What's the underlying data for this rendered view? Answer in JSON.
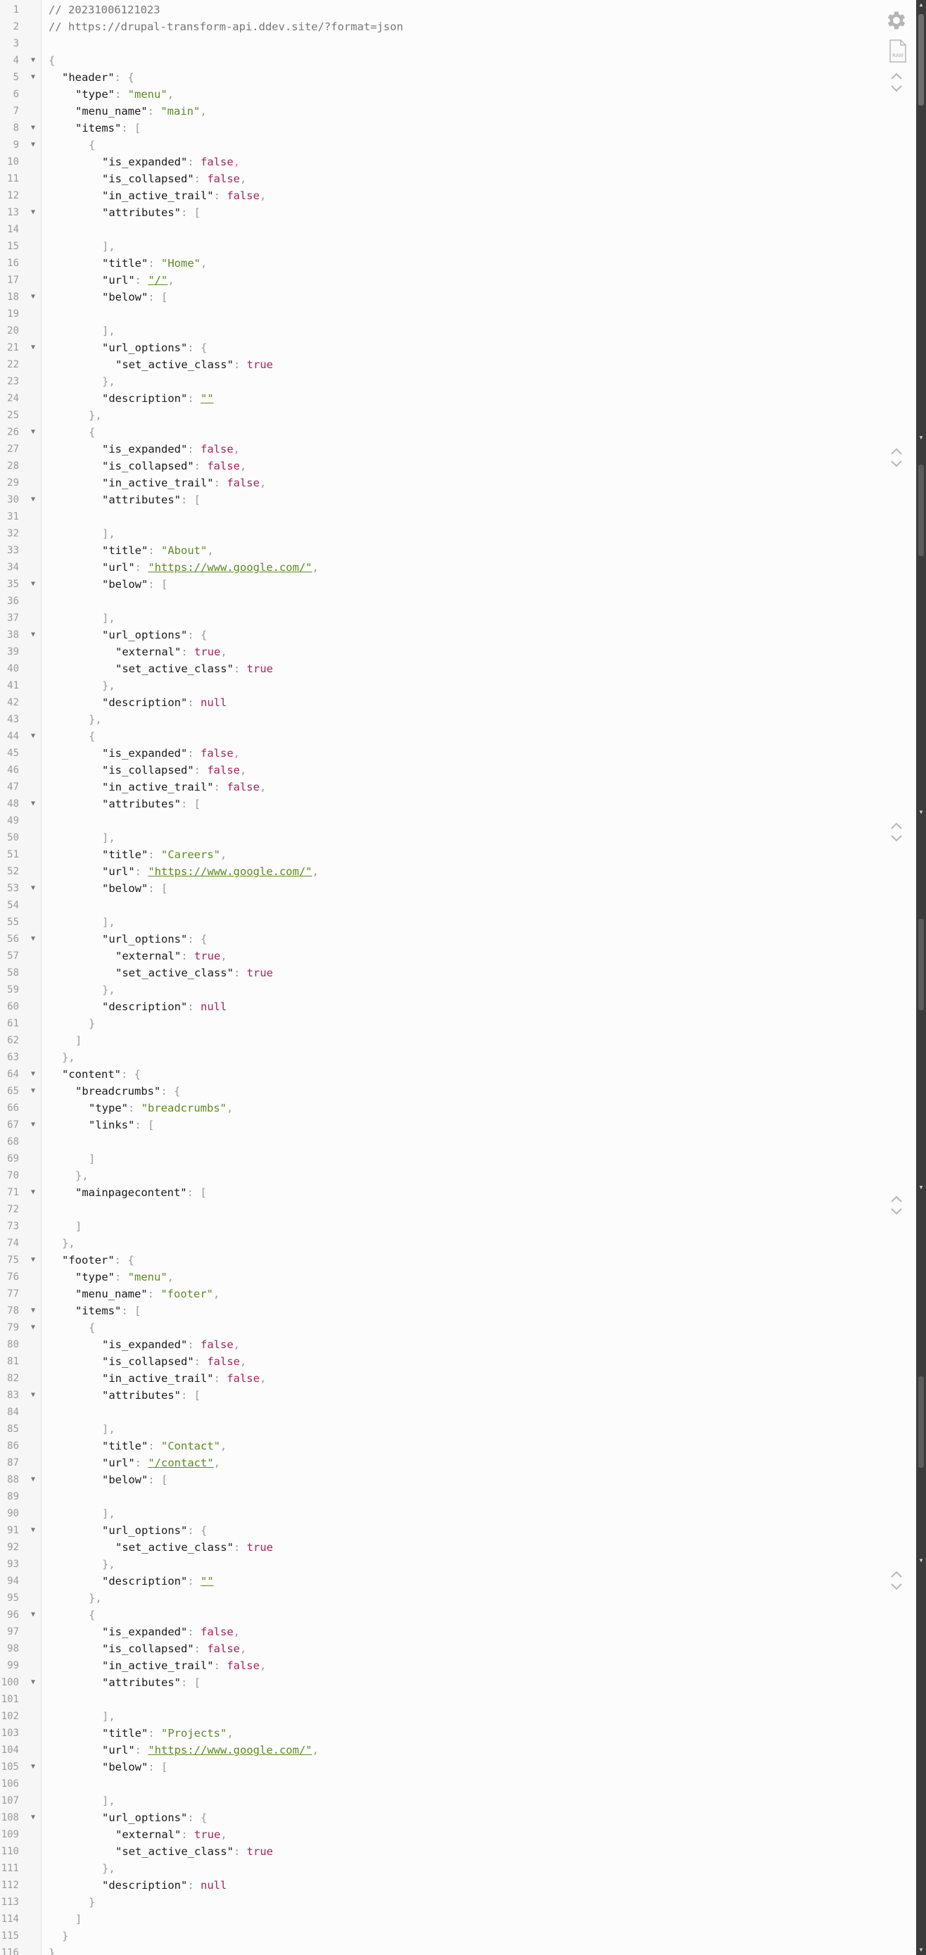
{
  "comments": [
    "// 20231006121023",
    "// https://drupal-transform-api.ddev.site/?format=json"
  ],
  "toolbar": {
    "settings_icon": "gear-icon",
    "raw_view_icon": "raw-document-icon",
    "raw_label": "RAW",
    "collapse_icon": "chevron-up-icon",
    "expand_icon": "chevron-down-icon"
  },
  "colors": {
    "key": "#1b1b1b",
    "string": "#5f8a22",
    "boolean_null": "#a6245a",
    "punctuation": "#9a9a9a",
    "comment": "#777777",
    "gutter": "#f6f6f6",
    "scrollbar": "#3b3b3b"
  },
  "json": {
    "header": {
      "type": "menu",
      "menu_name": "main",
      "items": [
        {
          "is_expanded": false,
          "is_collapsed": false,
          "in_active_trail": false,
          "attributes": [],
          "title": "Home",
          "url": "/",
          "below": [],
          "url_options": {
            "set_active_class": true
          },
          "description": ""
        },
        {
          "is_expanded": false,
          "is_collapsed": false,
          "in_active_trail": false,
          "attributes": [],
          "title": "About",
          "url": "https://www.google.com/",
          "below": [],
          "url_options": {
            "external": true,
            "set_active_class": true
          },
          "description": null
        },
        {
          "is_expanded": false,
          "is_collapsed": false,
          "in_active_trail": false,
          "attributes": [],
          "title": "Careers",
          "url": "https://www.google.com/",
          "below": [],
          "url_options": {
            "external": true,
            "set_active_class": true
          },
          "description": null
        }
      ]
    },
    "content": {
      "breadcrumbs": {
        "type": "breadcrumbs",
        "links": []
      },
      "mainpagecontent": []
    },
    "footer": {
      "type": "menu",
      "menu_name": "footer",
      "items": [
        {
          "is_expanded": false,
          "is_collapsed": false,
          "in_active_trail": false,
          "attributes": [],
          "title": "Contact",
          "url": "/contact",
          "below": [],
          "url_options": {
            "set_active_class": true
          },
          "description": ""
        },
        {
          "is_expanded": false,
          "is_collapsed": false,
          "in_active_trail": false,
          "attributes": [],
          "title": "Projects",
          "url": "https://www.google.com/",
          "below": [],
          "url_options": {
            "external": true,
            "set_active_class": true
          },
          "description": null
        }
      ]
    }
  }
}
